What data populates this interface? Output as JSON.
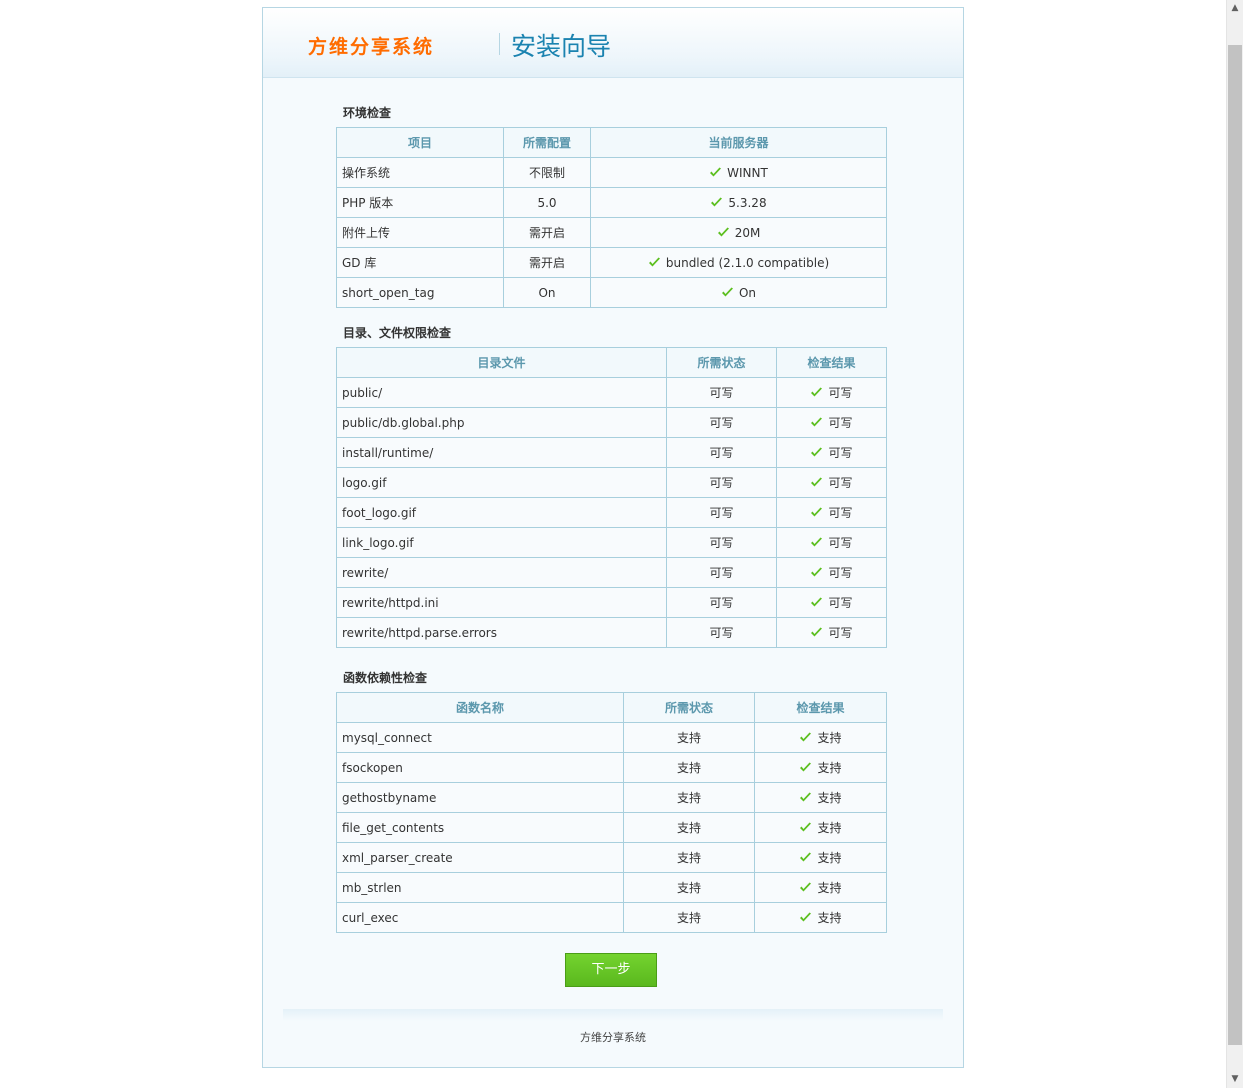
{
  "header": {
    "brand": "方维分享系统",
    "title": "安装向导"
  },
  "env": {
    "title": "环境检查",
    "headers": [
      "项目",
      "所需配置",
      "当前服务器"
    ],
    "rows": [
      {
        "item": "操作系统",
        "req": "不限制",
        "cur": "WINNT"
      },
      {
        "item": "PHP 版本",
        "req": "5.0",
        "cur": "5.3.28"
      },
      {
        "item": "附件上传",
        "req": "需开启",
        "cur": "20M"
      },
      {
        "item": "GD 库",
        "req": "需开启",
        "cur": "bundled (2.1.0 compatible)"
      },
      {
        "item": "short_open_tag",
        "req": "On",
        "cur": "On"
      }
    ]
  },
  "perm": {
    "title": "目录、文件权限检查",
    "headers": [
      "目录文件",
      "所需状态",
      "检查结果"
    ],
    "rows": [
      {
        "item": "public/",
        "req": "可写",
        "cur": "可写"
      },
      {
        "item": "public/db.global.php",
        "req": "可写",
        "cur": "可写"
      },
      {
        "item": "install/runtime/",
        "req": "可写",
        "cur": "可写"
      },
      {
        "item": "logo.gif",
        "req": "可写",
        "cur": "可写"
      },
      {
        "item": "foot_logo.gif",
        "req": "可写",
        "cur": "可写"
      },
      {
        "item": "link_logo.gif",
        "req": "可写",
        "cur": "可写"
      },
      {
        "item": "rewrite/",
        "req": "可写",
        "cur": "可写"
      },
      {
        "item": "rewrite/httpd.ini",
        "req": "可写",
        "cur": "可写"
      },
      {
        "item": "rewrite/httpd.parse.errors",
        "req": "可写",
        "cur": "可写"
      }
    ]
  },
  "func": {
    "title": "函数依赖性检查",
    "headers": [
      "函数名称",
      "所需状态",
      "检查结果"
    ],
    "rows": [
      {
        "item": "mysql_connect",
        "req": "支持",
        "cur": "支持"
      },
      {
        "item": "fsockopen",
        "req": "支持",
        "cur": "支持"
      },
      {
        "item": "gethostbyname",
        "req": "支持",
        "cur": "支持"
      },
      {
        "item": "file_get_contents",
        "req": "支持",
        "cur": "支持"
      },
      {
        "item": "xml_parser_create",
        "req": "支持",
        "cur": "支持"
      },
      {
        "item": "mb_strlen",
        "req": "支持",
        "cur": "支持"
      },
      {
        "item": "curl_exec",
        "req": "支持",
        "cur": "支持"
      }
    ]
  },
  "next_label": "下一步",
  "footer": "方维分享系统",
  "icons": {
    "check": "check-icon",
    "check_color": "#5cbf1f"
  }
}
